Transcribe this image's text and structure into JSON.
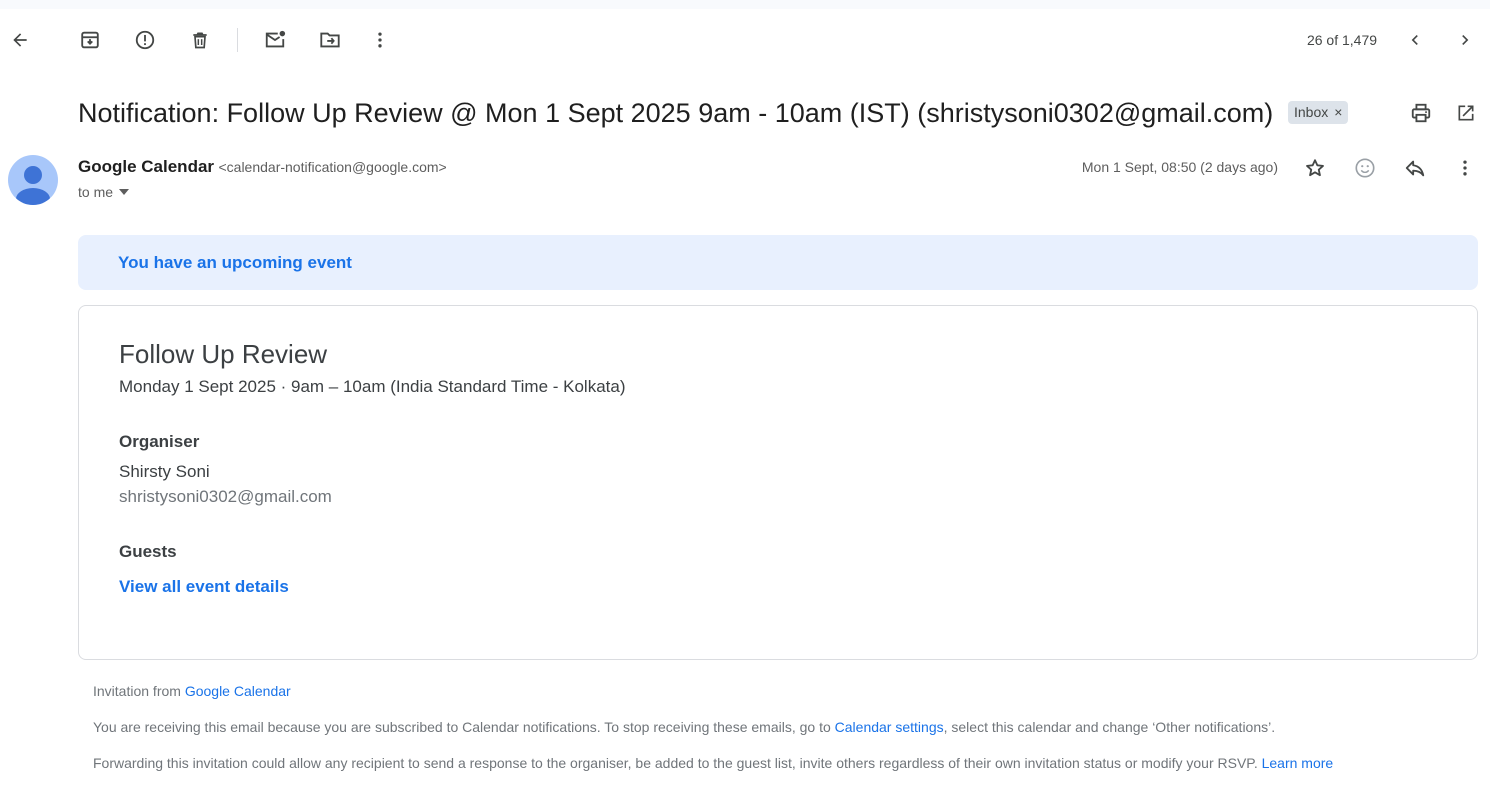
{
  "toolbar": {
    "counter": "26 of 1,479",
    "icons": [
      "back-arrow-icon",
      "archive-icon",
      "report-spam-icon",
      "delete-icon",
      "mark-unread-icon",
      "move-to-icon",
      "more-vert-icon",
      "chevron-left-icon",
      "chevron-right-icon"
    ]
  },
  "message": {
    "subject": "Notification: Follow Up Review @ Mon 1 Sept 2025 9am - 10am (IST) (shristysoni0302@gmail.com)",
    "label_chip": "Inbox",
    "label_chip_close": "×",
    "sender_name": "Google Calendar",
    "sender_email": "<calendar-notification@google.com>",
    "recipient": "to me",
    "date": "Mon 1 Sept, 08:50 (2 days ago)"
  },
  "banner": {
    "text": "You have an upcoming event"
  },
  "event": {
    "title": "Follow Up Review",
    "when": "Monday 1 Sept 2025 · 9am – 10am (India Standard Time - Kolkata)",
    "organiser_label": "Organiser",
    "organiser_name": "Shirsty Soni",
    "organiser_email": "shristysoni0302@gmail.com",
    "guests_label": "Guests",
    "view_details": "View all event details"
  },
  "footer": {
    "invitation_prefix": "Invitation from ",
    "invitation_link": "Google Calendar",
    "subscribed_prefix": "You are receiving this email because you are subscribed to Calendar notifications. To stop receiving these emails, go to ",
    "subscribed_link": "Calendar settings",
    "subscribed_suffix": ", select this calendar and change ‘Other notifications’.",
    "forwarding_text": "Forwarding this invitation could allow any recipient to send a response to the organiser, be added to the guest list, invite others regardless of their own invitation status or modify your RSVP. ",
    "forwarding_link": "Learn more"
  },
  "colors": {
    "accent": "#1a73e8",
    "banner_bg": "#e8f0fe",
    "chip_bg": "#dde3ea",
    "icon": "#444746"
  }
}
